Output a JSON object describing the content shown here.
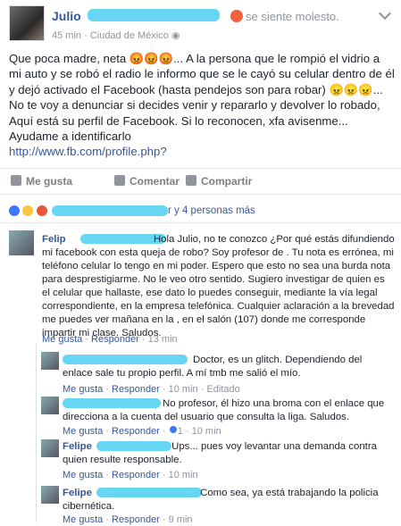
{
  "post": {
    "author": "Julio",
    "feeling": "se siente molesto.",
    "time": "45 min",
    "location": "Ciudad de México",
    "body": "Que poca madre, neta 😡😡😡... A la persona que le rompió el vidrio a mi auto y se robó el radio le informo que se le cayó su celular dentro de él y dejó activado el Facebook (hasta pendejos son para robar) 😠😠😠... No te voy a denunciar si decides venir y repararlo y devolver lo robado, Aquí está su perfil de Facebook. Si lo reconocen, xfa avisenme... Ayudame a identificarlo",
    "link": "http://www.fb.com/profile.php?"
  },
  "actions": {
    "like": "Me gusta",
    "comment": "Comentar",
    "share": "Compartir"
  },
  "reactions": {
    "summary": "r y 4 personas más"
  },
  "comments": [
    {
      "name": "Felip",
      "text": "Hola Julio, no te conozco ¿Por qué estás difundiendo mi facebook con esta queja de robo? Soy profesor de . Tu nota es errónea, mi teléfono celular lo tengo en mi poder. Espero que esto no sea una burda nota para desprestigiarme. No le veo otro sentido. Sugiero investigar de quien es el celular que hallaste, ese dato lo puedes conseguir, mediante la vía legal correspondiente, en la empresa telefónica. Cualquier aclaración a la brevedad me puedes ver mañana en la , en el salón (107) donde me corresponde impartir mi clase. Saludos.",
      "like": "Me gusta",
      "reply": "Responder",
      "time": "13 min"
    },
    {
      "name": "",
      "text": "Doctor, es un glitch. Dependiendo del enlace sale tu propio perfil. A mí tmb me salió el mío.",
      "like": "Me gusta",
      "reply": "Responder",
      "time": "10 min",
      "edited": "Editado"
    },
    {
      "name": "",
      "text": "No profesor, él hizo una broma con el enlace que direcciona a la cuenta del usuario que consulta la liga. Saludos.",
      "like": "Me gusta",
      "reply": "Responder",
      "likes": "1",
      "time": "10 min"
    },
    {
      "name": "Felipe",
      "text": "Ups... pues voy levantar una demanda contra quien resulte responsable.",
      "like": "Me gusta",
      "reply": "Responder",
      "time": "10 min"
    },
    {
      "name": "Felipe",
      "text": "Como sea, ya está trabajando la policia cibernética.",
      "like": "Me gusta",
      "reply": "Responder",
      "time": "9 min"
    }
  ],
  "colors": {
    "link": "#365899",
    "meta": "#90949c",
    "redaction": "#5fd4f2"
  }
}
